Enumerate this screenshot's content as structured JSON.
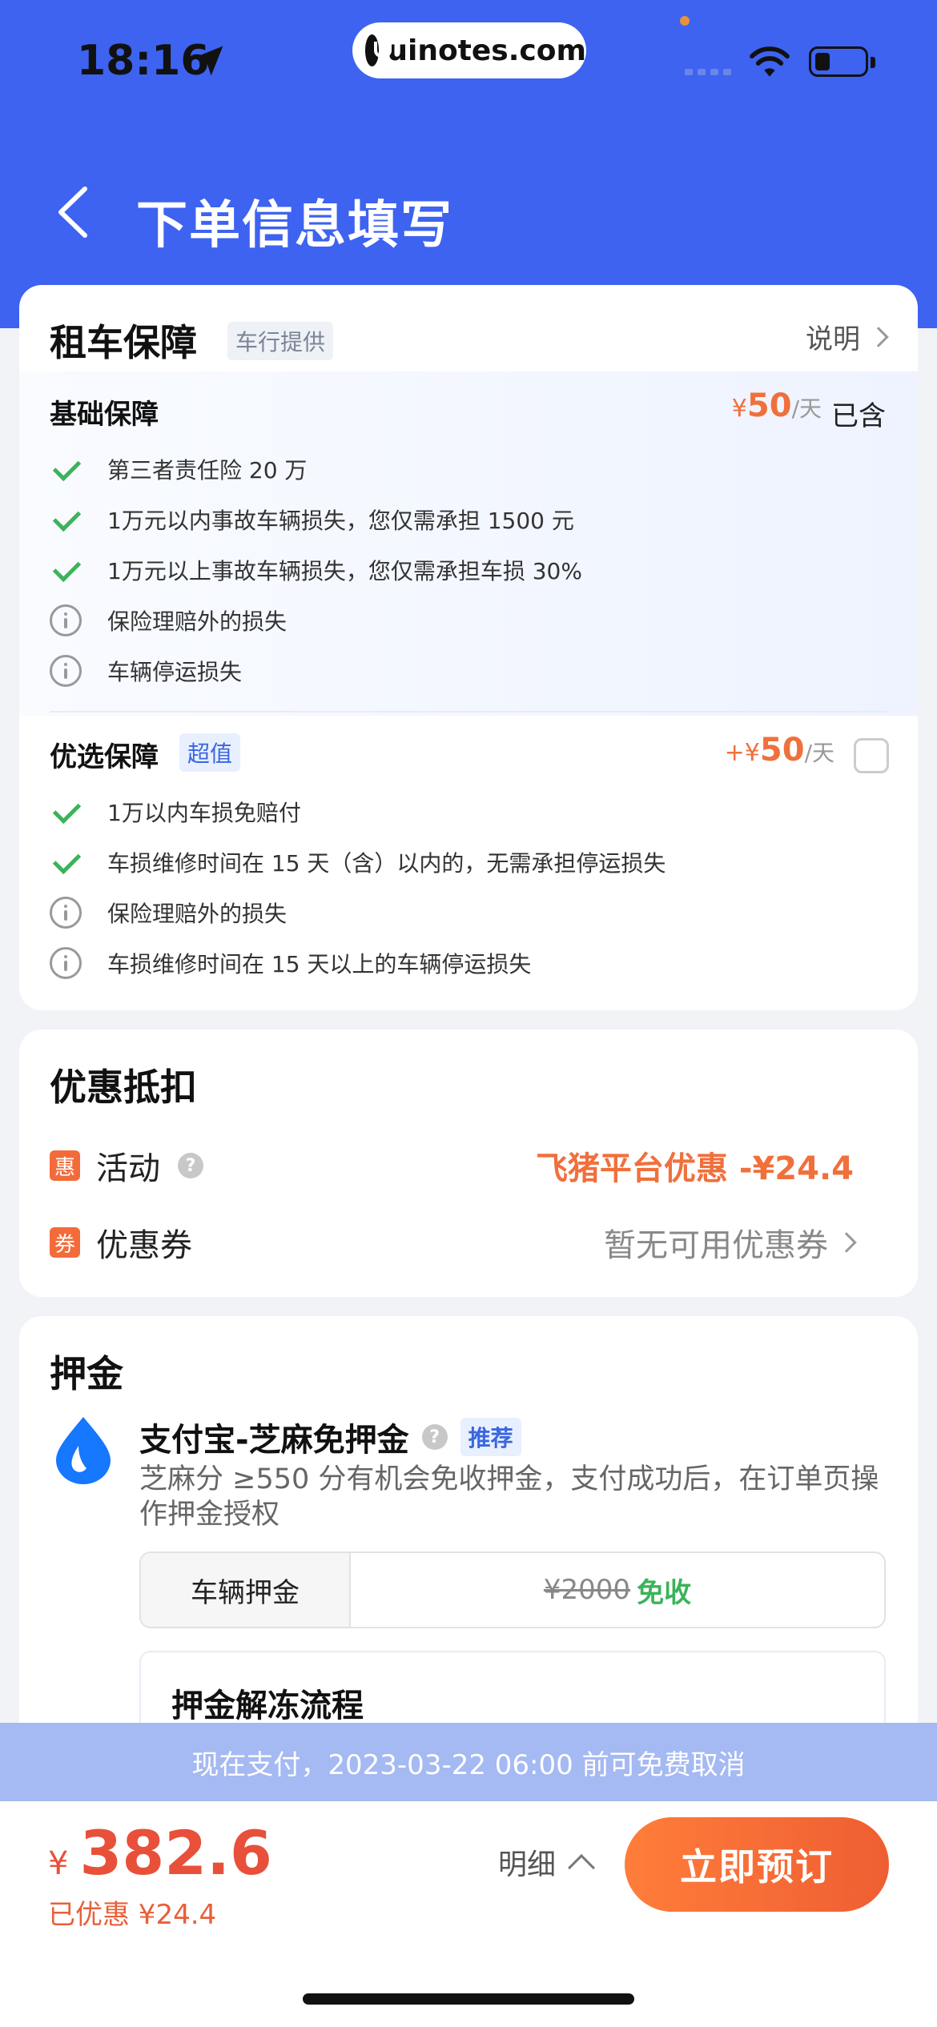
{
  "status_bar": {
    "time": "18:16",
    "url": "uinotes.com"
  },
  "nav": {
    "title": "下单信息填写"
  },
  "protection": {
    "title": "租车保障",
    "provider_tag": "车行提供",
    "explain_label": "说明",
    "basic": {
      "title": "基础保障",
      "price_currency": "¥",
      "price_value": "50",
      "price_unit": "/天",
      "status": "已含",
      "items": [
        {
          "icon": "check-icon",
          "text": "第三者责任险 20 万"
        },
        {
          "icon": "check-icon",
          "text": "1万元以内事故车辆损失，您仅需承担 1500 元"
        },
        {
          "icon": "check-icon",
          "text": "1万元以上事故车辆损失，您仅需承担车损 30%"
        },
        {
          "icon": "info-icon",
          "text": "保险理赔外的损失"
        },
        {
          "icon": "info-icon",
          "text": "车辆停运损失"
        }
      ]
    },
    "premium": {
      "title": "优选保障",
      "tag": "超值",
      "price_prefix": "+¥",
      "price_value": "50",
      "price_unit": "/天",
      "items": [
        {
          "icon": "check-icon",
          "text": "1万以内车损免赔付"
        },
        {
          "icon": "check-icon",
          "text": "车损维修时间在 15 天（含）以内的，无需承担停运损失"
        },
        {
          "icon": "info-icon",
          "text": "保险理赔外的损失"
        },
        {
          "icon": "info-icon",
          "text": "车损维修时间在 15 天以上的车辆停运损失"
        }
      ]
    }
  },
  "discount": {
    "title": "优惠抵扣",
    "activity": {
      "badge": "惠",
      "label": "活动",
      "value": "飞猪平台优惠 -¥24.4"
    },
    "coupon": {
      "badge": "券",
      "label": "优惠券",
      "value": "暂无可用优惠券"
    }
  },
  "deposit": {
    "title": "押金",
    "method": "支付宝-芝麻免押金",
    "method_tag": "推荐",
    "description": "芝麻分 ≥550 分有机会免收押金，支付成功后，在订单页操作押金授权",
    "vehicle_label": "车辆押金",
    "vehicle_original": "¥2000",
    "vehicle_status": "免收",
    "flow_title": "押金解冻流程"
  },
  "notice": "现在支付，2023-03-22 06:00 前可免费取消",
  "footer": {
    "currency": "¥",
    "total": "382.6",
    "saved": "已优惠 ¥24.4",
    "detail_label": "明细",
    "book_label": "立即预订"
  },
  "colors": {
    "primary": "#3d63f0",
    "accent": "#f0703c",
    "success": "#3cb35a"
  }
}
